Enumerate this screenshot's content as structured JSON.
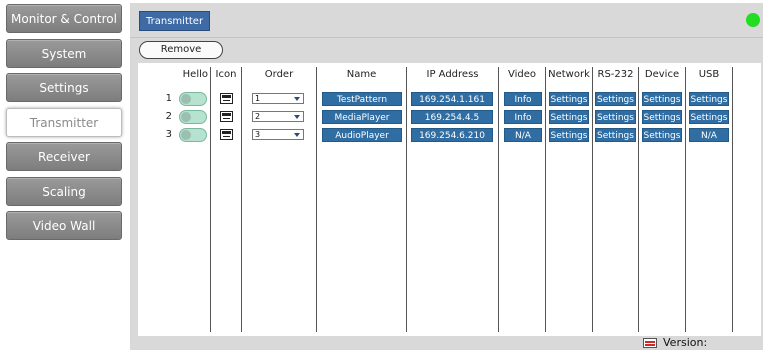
{
  "sidebar": {
    "items": [
      {
        "label": "Monitor & Control"
      },
      {
        "label": "System"
      },
      {
        "label": "Settings"
      },
      {
        "label": "Transmitter"
      },
      {
        "label": "Receiver"
      },
      {
        "label": "Scaling"
      },
      {
        "label": "Video Wall"
      }
    ],
    "active": "Transmitter"
  },
  "header": {
    "tab_label": "Transmitter",
    "status_color": "#22dd22"
  },
  "toolbar": {
    "remove_label": "Remove"
  },
  "table": {
    "columns": [
      "Hello",
      "Icon",
      "Order",
      "Name",
      "IP Address",
      "Video",
      "Network",
      "RS-232",
      "Device",
      "USB"
    ],
    "rows": [
      {
        "num": "1",
        "hello_on": true,
        "icon": "device-icon",
        "order": "1",
        "name": "TestPattern",
        "ip": "169.254.1.161",
        "video": "Info",
        "network": "Settings",
        "rs232": "Settings",
        "device": "Settings",
        "usb": "Settings"
      },
      {
        "num": "2",
        "hello_on": true,
        "icon": "device-icon",
        "order": "2",
        "name": "MediaPlayer",
        "ip": "169.254.4.5",
        "video": "Info",
        "network": "Settings",
        "rs232": "Settings",
        "device": "Settings",
        "usb": "Settings"
      },
      {
        "num": "3",
        "hello_on": true,
        "icon": "device-icon",
        "order": "3",
        "name": "AudioPlayer",
        "ip": "169.254.6.210",
        "video": "N/A",
        "network": "Settings",
        "rs232": "Settings",
        "device": "Settings",
        "usb": "N/A"
      }
    ]
  },
  "footer": {
    "version_label": "Version:"
  },
  "colors": {
    "accent_blue": "#2f6da3",
    "tab_blue": "#3e6aa6",
    "panel_gray": "#d9d9d9",
    "sidebar_gray": "#8a8a8a"
  }
}
